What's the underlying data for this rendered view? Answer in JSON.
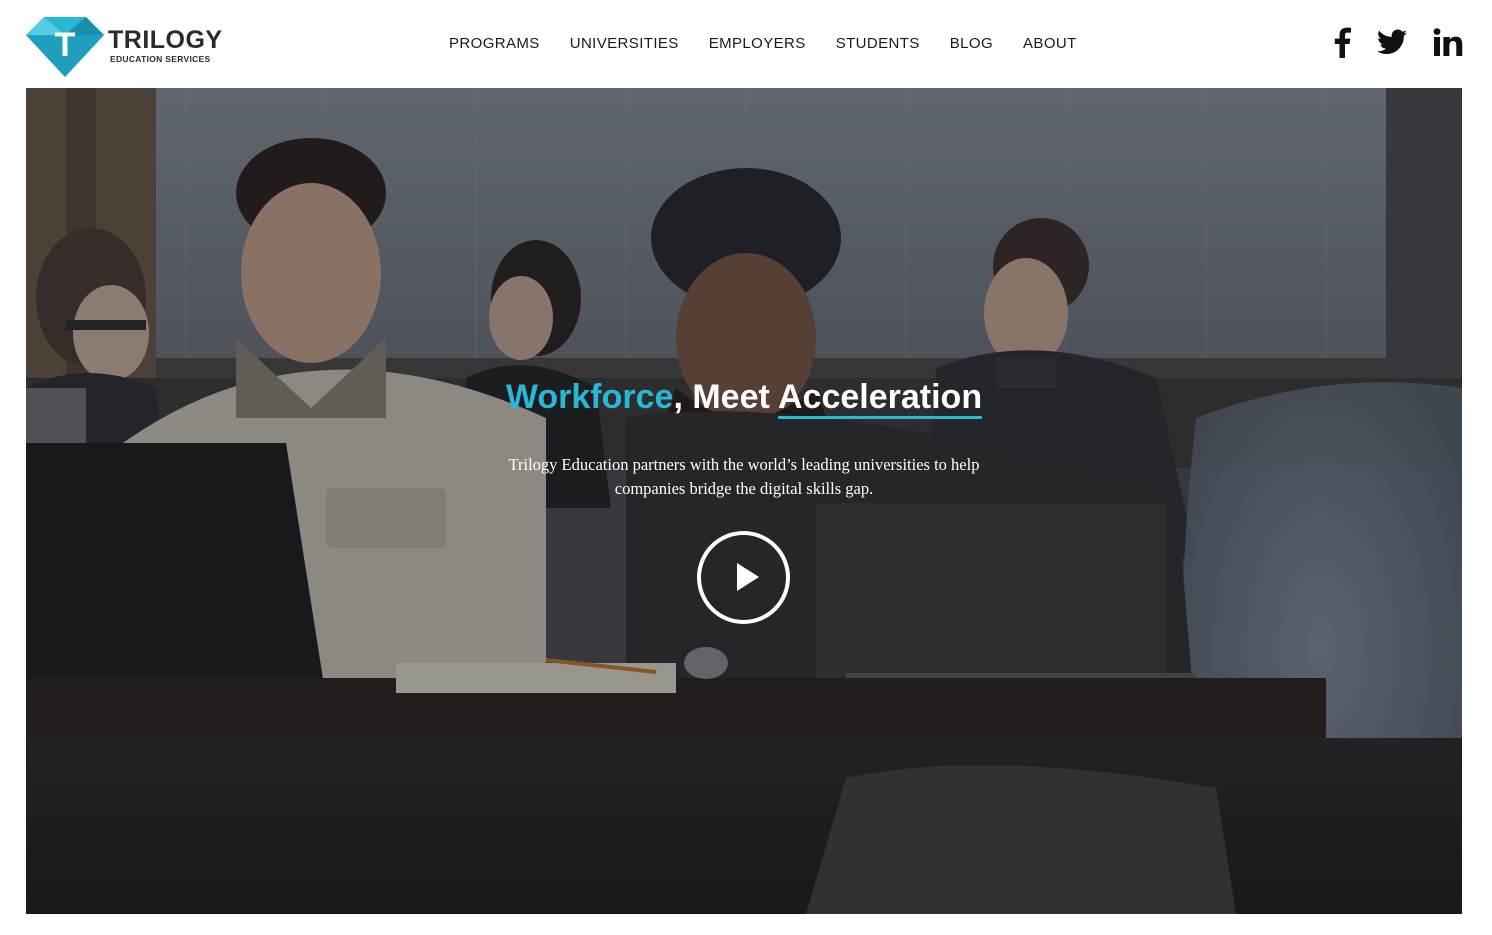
{
  "header": {
    "logo": {
      "wordmark": "TRILOGY",
      "tagline": "EDUCATION SERVICES",
      "mark_letter": "T",
      "brand_color": "#2ab7d6"
    },
    "nav": [
      {
        "label": "PROGRAMS"
      },
      {
        "label": "UNIVERSITIES"
      },
      {
        "label": "EMPLOYERS"
      },
      {
        "label": "STUDENTS"
      },
      {
        "label": "BLOG"
      },
      {
        "label": "ABOUT"
      }
    ],
    "social": [
      {
        "icon": "facebook-icon"
      },
      {
        "icon": "twitter-icon"
      },
      {
        "icon": "linkedin-icon"
      }
    ]
  },
  "hero": {
    "title_part1": "Workforce",
    "title_sep": ", ",
    "title_part2": "Meet ",
    "title_part3": "Acceleration",
    "description": "Trilogy Education partners with the world’s leading universities to help companies bridge the digital skills gap.",
    "play_icon": "play-icon",
    "accent_color": "#2ab7d6"
  }
}
